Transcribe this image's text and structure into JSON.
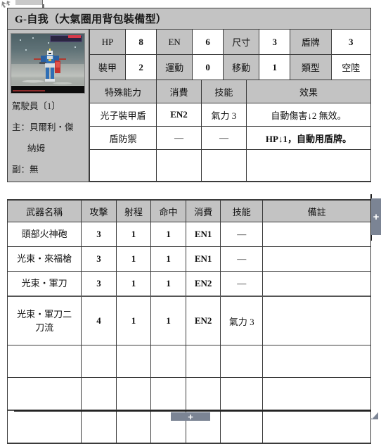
{
  "card": {
    "title": "G-自我（大氣圈用背包裝備型）"
  },
  "unit_image": {
    "alt": "mecha-sprite-thumbnail"
  },
  "pilot": {
    "header": "駕駛員〔1〕",
    "main": "主：貝爾利・傑",
    "main_cont": "納姆",
    "sub": "副：無"
  },
  "stats": {
    "rows": [
      [
        {
          "label": "HP",
          "value": "8"
        },
        {
          "label": "EN",
          "value": "6"
        },
        {
          "label": "尺寸",
          "value": "3"
        },
        {
          "label": "盾牌",
          "value": "3"
        }
      ],
      [
        {
          "label": "裝甲",
          "value": "2"
        },
        {
          "label": "運動",
          "value": "0"
        },
        {
          "label": "移動",
          "value": "1"
        },
        {
          "label": "類型",
          "value": "空陸"
        }
      ]
    ]
  },
  "special": {
    "headers": [
      "特殊能力",
      "消費",
      "技能",
      "效果"
    ],
    "rows": [
      {
        "name": "光子裝甲盾",
        "cost": "EN2",
        "skill": "氣力 3",
        "effect": "自動傷害↓2 無效。"
      },
      {
        "name": "盾防禦",
        "cost": "—",
        "skill": "—",
        "effect": "HP↓1，自動用盾牌。"
      },
      {
        "name": "",
        "cost": "",
        "skill": "",
        "effect": ""
      }
    ]
  },
  "weapons": {
    "headers": [
      "武器名稱",
      "攻擊",
      "射程",
      "命中",
      "消費",
      "技能",
      "備註"
    ],
    "rows": [
      {
        "name": "頭部火神砲",
        "name2": "",
        "atk": "3",
        "range": "1",
        "hit": "1",
        "cost": "EN1",
        "skill": "—",
        "note": ""
      },
      {
        "name": "光束・來福槍",
        "name2": "",
        "atk": "3",
        "range": "1",
        "hit": "1",
        "cost": "EN1",
        "skill": "—",
        "note": ""
      },
      {
        "name": "光束・軍刀",
        "name2": "",
        "atk": "3",
        "range": "1",
        "hit": "1",
        "cost": "EN2",
        "skill": "—",
        "note": ""
      },
      {
        "name": "光束・軍刀二",
        "name2": "刀流",
        "atk": "4",
        "range": "1",
        "hit": "1",
        "cost": "EN2",
        "skill": "氣力 3",
        "note": ""
      },
      {
        "name": "",
        "name2": "",
        "atk": "",
        "range": "",
        "hit": "",
        "cost": "",
        "skill": "",
        "note": ""
      },
      {
        "name": "",
        "name2": "",
        "atk": "",
        "range": "",
        "hit": "",
        "cost": "",
        "skill": "",
        "note": ""
      },
      {
        "name": "",
        "name2": "",
        "atk": "",
        "range": "",
        "hit": "",
        "cost": "",
        "skill": "",
        "note": ""
      }
    ]
  },
  "controls": {
    "add_row_right": "+",
    "add_row_bottom": "+"
  },
  "colors": {
    "header_gray": "#c3c3c3",
    "border_dark": "#3b3b3b",
    "control_slate": "#7b8494"
  }
}
